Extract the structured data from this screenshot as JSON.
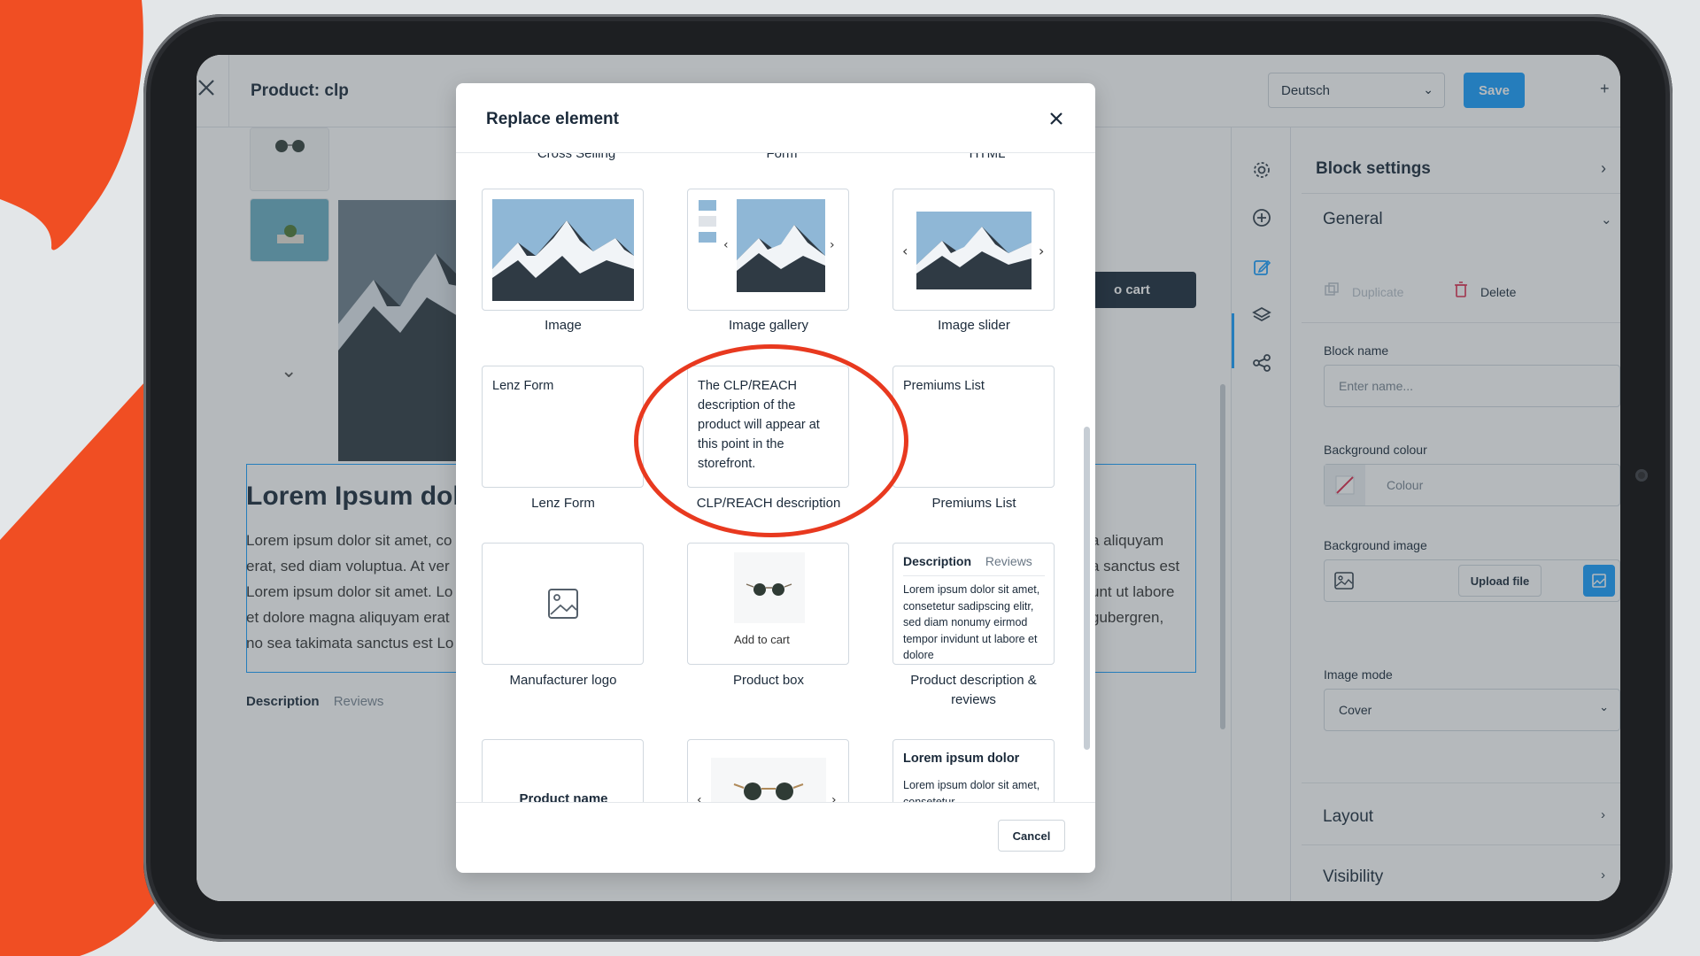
{
  "editor": {
    "page_title": "Product: clp",
    "language": "Deutsch",
    "save_label": "Save",
    "preview": {
      "title": "Lorem Ipsum dol",
      "text_left": [
        "Lorem ipsum dolor sit amet, co",
        "erat, sed diam voluptua. At ver",
        "Lorem ipsum dolor sit amet. Lo",
        "et dolore magna aliquyam erat",
        "no sea takimata sanctus est Lo"
      ],
      "text_right": [
        "a aliquyam",
        "a sanctus est",
        "unt ut labore",
        "gubergren,"
      ],
      "add_to_cart": "o cart",
      "tab_description": "Description",
      "tab_reviews": "Reviews"
    }
  },
  "settings": {
    "title": "Block settings",
    "general": "General",
    "duplicate": "Duplicate",
    "delete": "Delete",
    "block_name_label": "Block name",
    "block_name_placeholder": "Enter name...",
    "bg_colour_label": "Background colour",
    "colour_placeholder": "Colour",
    "bg_image_label": "Background image",
    "upload_label": "Upload file",
    "image_mode_label": "Image mode",
    "image_mode_value": "Cover",
    "layout": "Layout",
    "visibility": "Visibility"
  },
  "modal": {
    "title": "Replace element",
    "cancel_label": "Cancel",
    "cut_labels": [
      "Cross Selling",
      "Form",
      "HTML"
    ],
    "tiles": [
      {
        "label": "Image"
      },
      {
        "label": "Image gallery"
      },
      {
        "label": "Image slider"
      },
      {
        "label": "Lenz Form",
        "content": "Lenz Form"
      },
      {
        "label": "CLP/REACH description",
        "content": "The CLP/REACH description of the product will appear at this point in the storefront."
      },
      {
        "label": "Premiums List",
        "content": "Premiums List"
      },
      {
        "label": "Manufacturer logo"
      },
      {
        "label": "Product box",
        "content": "Add to cart"
      },
      {
        "label": "Product description & reviews",
        "tab_a": "Description",
        "tab_b": "Reviews",
        "content": "Lorem ipsum dolor sit amet, consetetur sadipscing elitr, sed diam nonumy eirmod tempor invidunt ut labore et dolore"
      },
      {
        "content": "Product name"
      },
      {
        "content": ""
      },
      {
        "title": "Lorem ipsum dolor",
        "content": "Lorem ipsum dolor sit amet, consetetur"
      }
    ]
  },
  "colors": {
    "accent": "#189eff",
    "highlight": "#e8391f",
    "brand_orange": "#f04e23"
  }
}
